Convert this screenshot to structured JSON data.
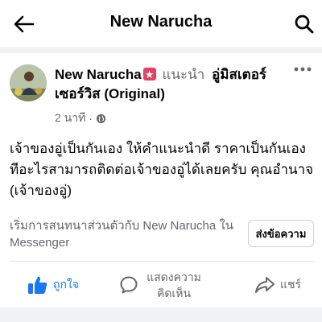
{
  "header": {
    "title": "New Narucha",
    "back_icon": "arrow-left-icon",
    "search_icon": "search-icon"
  },
  "post": {
    "author": "New Narucha",
    "recommends": "แนะนำ",
    "recommended_page": "อู่มิสเตอร์เซอร์วิส (Original)",
    "time": "2 นาที",
    "separator": "·",
    "body": "เจ้าของอู่เป็นกันเอง ให้คำแนะนำดี ราคาเป็นกันเอง ทีอะไรสามารถติดต่อเจ้าของอู่ได้เลยครับ คุณอำนาจ (เจ้าของอู่)"
  },
  "messenger": {
    "prompt": "เริ่มการสนทนาส่วนตัวกับ New Narucha ใน Messenger",
    "button": "ส่งข้อความ"
  },
  "actions": {
    "like": "ถูกใจ",
    "comment": "แสดงความคิดเห็น",
    "share": "แชร์"
  },
  "colors": {
    "accent": "#1877f2",
    "secondary_text": "#65676b",
    "badge": "#e64160"
  }
}
